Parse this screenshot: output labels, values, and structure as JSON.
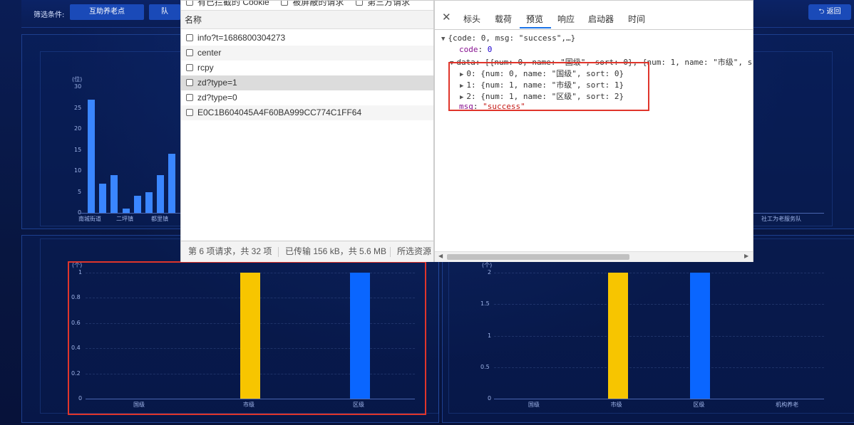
{
  "dashboard": {
    "filter_label": "筛选条件:",
    "filter_buttons": [
      "互助养老点",
      "队"
    ],
    "back_label": "返回",
    "top_chart": {
      "unit": "(位)",
      "y_ticks": [
        "30",
        "25",
        "20",
        "15",
        "10",
        "5",
        "0"
      ],
      "values": [
        27,
        7,
        9,
        1,
        4,
        5,
        9,
        14
      ],
      "x_labels": [
        "南城街道",
        "二坪镇",
        "都里镇"
      ],
      "right_label": "社工为老服务队"
    },
    "left_chart": {
      "unit": "(个)",
      "y_ticks": [
        "1",
        "0.8",
        "0.6",
        "0.4",
        "0.2",
        "0"
      ],
      "categories": [
        "国级",
        "市级",
        "区级"
      ],
      "values": [
        0,
        1,
        1
      ],
      "colors": [
        "#f7c500",
        "#f7c500",
        "#0a66ff"
      ]
    },
    "right_chart": {
      "unit": "(个)",
      "y_ticks": [
        "2",
        "1.5",
        "1",
        "0.5",
        "0"
      ],
      "categories": [
        "国级",
        "市级",
        "区级",
        "机构养老"
      ],
      "values": [
        0,
        2,
        2,
        0
      ],
      "colors": [
        "#f7c500",
        "#f7c500",
        "#0a66ff",
        "#0a66ff"
      ]
    }
  },
  "devtools": {
    "filter_checks": [
      "有已拦截的 Cookie",
      "被屏蔽的请求",
      "第三方请求"
    ],
    "name_header": "名称",
    "requests": [
      "info?t=1686800304273",
      "center",
      "rcpy",
      "zd?type=1",
      "zd?type=0",
      "E0C1B604045A4F60BA999CC774C1FF64"
    ],
    "selected_index": 3,
    "status": {
      "requests": "第 6 项请求，共 32 项",
      "transfer": "已传输 156 kB，共 5.6 MB",
      "resources": "所选资源"
    },
    "tabs": [
      "标头",
      "载荷",
      "预览",
      "响应",
      "启动器",
      "时间"
    ],
    "active_tab": "预览",
    "preview": {
      "root": "{code: 0, msg: \"success\",…}",
      "code_key": "code",
      "code_val": "0",
      "data_line": "data: [{num: 0, name: \"国级\", sort: 0}, {num: 1, name: \"市级\", s",
      "items": [
        "0: {num: 0, name: \"国级\", sort: 0}",
        "1: {num: 1, name: \"市级\", sort: 1}",
        "2: {num: 1, name: \"区级\", sort: 2}"
      ],
      "msg_key": "msg",
      "msg_val": "\"success\""
    }
  },
  "chart_data": [
    {
      "type": "bar",
      "categories": [
        "国级",
        "市级",
        "区级"
      ],
      "values": [
        0,
        1,
        1
      ],
      "ylabel": "(个)",
      "ylim": [
        0,
        1
      ]
    },
    {
      "type": "bar",
      "categories": [
        "国级",
        "市级",
        "区级",
        "机构养老"
      ],
      "values": [
        0,
        2,
        2,
        0
      ],
      "ylabel": "(个)",
      "ylim": [
        0,
        2
      ]
    }
  ]
}
